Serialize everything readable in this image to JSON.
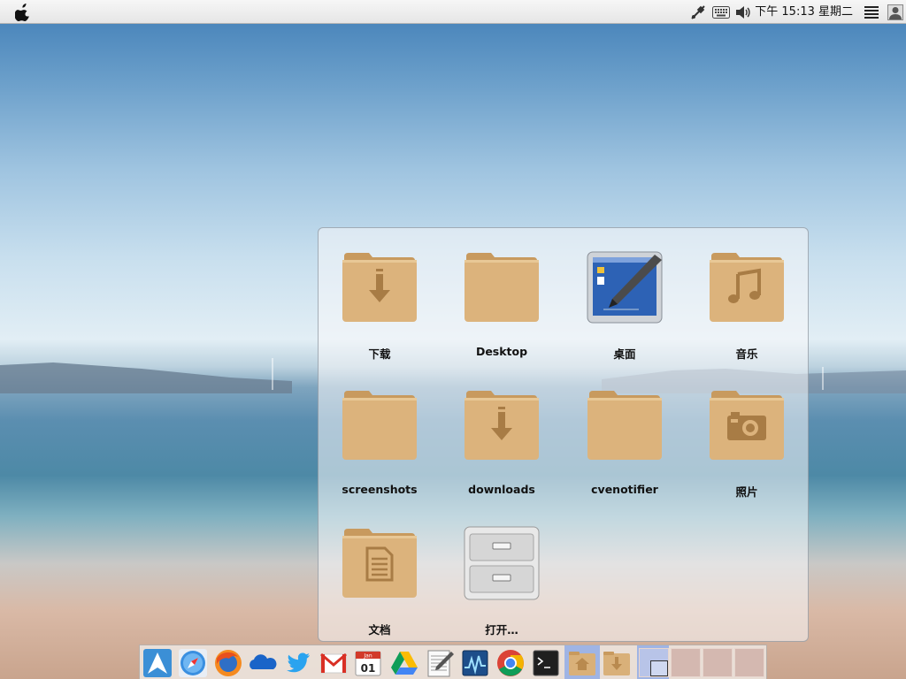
{
  "topbar": {
    "apple_menu": "apple-logo",
    "clock": "下午 15:13 星期二",
    "tray_icons": [
      "network-icon",
      "keyboard-icon",
      "volume-icon",
      "menu-icon",
      "user-icon"
    ]
  },
  "popup": {
    "items": [
      {
        "label": "下载",
        "icon": "folder-download-icon"
      },
      {
        "label": "Desktop",
        "icon": "folder-icon"
      },
      {
        "label": "桌面",
        "icon": "desktop-icon"
      },
      {
        "label": "音乐",
        "icon": "folder-music-icon"
      },
      {
        "label": "screenshots",
        "icon": "folder-icon"
      },
      {
        "label": "downloads",
        "icon": "folder-download-icon"
      },
      {
        "label": "cvenotifier",
        "icon": "folder-icon"
      },
      {
        "label": "照片",
        "icon": "folder-camera-icon"
      },
      {
        "label": "文档",
        "icon": "folder-document-icon"
      },
      {
        "label": "打开…",
        "icon": "file-cabinet-icon"
      }
    ]
  },
  "dock": {
    "items": [
      "arch-linux-icon",
      "safari-icon",
      "firefox-icon",
      "onedrive-icon",
      "twitter-icon",
      "gmail-icon",
      "calendar-icon",
      "google-drive-icon",
      "text-editor-icon",
      "system-monitor-icon",
      "chrome-icon",
      "terminal-icon",
      "home-folder-icon",
      "downloads-folder-icon"
    ],
    "calendar_day": "01",
    "calendar_month": "Jan",
    "workspaces": 4
  },
  "colors": {
    "folder": "#d9b079",
    "folder_dark": "#b98a4f",
    "dock_active": "#9fb4e4"
  }
}
